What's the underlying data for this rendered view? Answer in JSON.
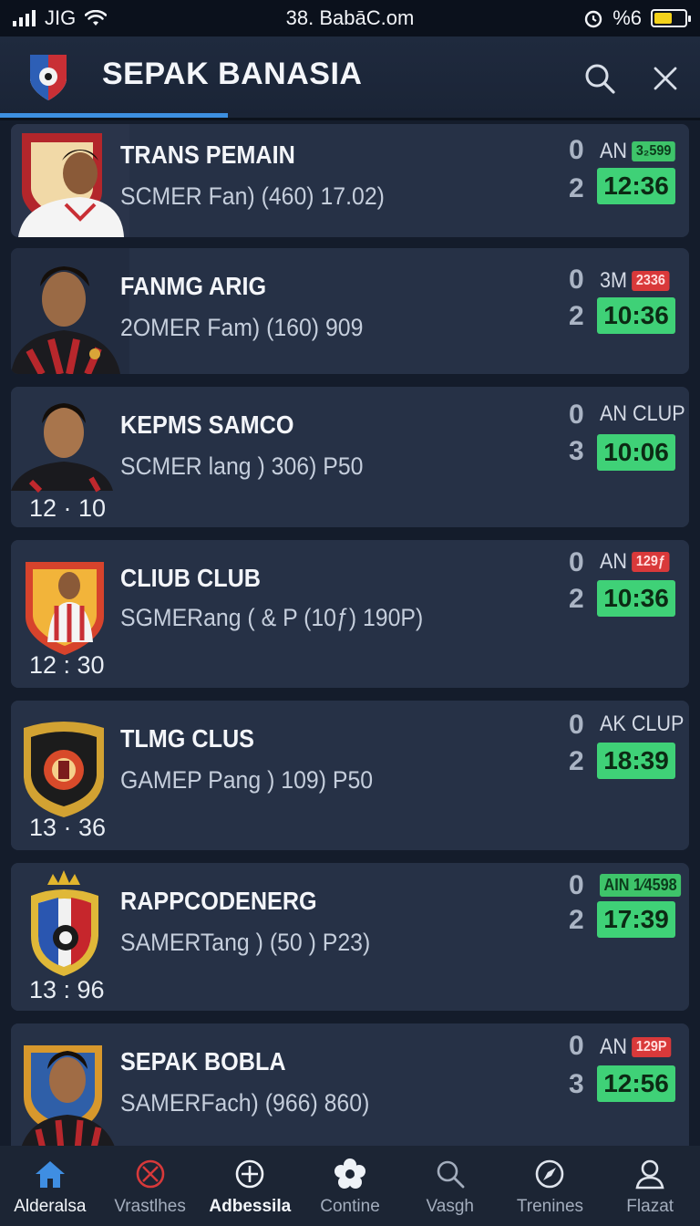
{
  "status": {
    "carrier": "JIG",
    "url": "38. BabāC.om",
    "battery_pct": "%6",
    "battery_level": 0.6
  },
  "header": {
    "title": "SEPAK BANASIA"
  },
  "matches": [
    {
      "name": "TRANS PEMAIN",
      "sub": "SCMER Fan) (460) 17.02)",
      "score_top": "0",
      "meta": "AN",
      "tag": "3₂599",
      "tag_color": "green",
      "score_bottom": "2",
      "time": "12:36",
      "kickoff": ""
    },
    {
      "name": "FANMG ARIG",
      "sub": "2OMER Fam) (160) 909",
      "score_top": "0",
      "meta": "3M",
      "tag": "2336",
      "tag_color": "red",
      "score_bottom": "2",
      "time": "10:36",
      "kickoff": ""
    },
    {
      "name": "KEPMS SAMCO",
      "sub": "SCMER lang ) 306) P50",
      "score_top": "0",
      "meta": "AN CLUP",
      "tag": "",
      "tag_color": "",
      "score_bottom": "3",
      "time": "10:06",
      "kickoff": "12 · 10"
    },
    {
      "name": "CLIUB CLUB",
      "sub": "SGMERang ( & P (10ƒ) 190P)",
      "score_top": "0",
      "meta": "AN",
      "tag": "129ƒ",
      "tag_color": "red",
      "score_bottom": "2",
      "time": "10:36",
      "kickoff": "12 : 30"
    },
    {
      "name": "TLMG CLUS",
      "sub": "GAMEP Pang ) 109) P50",
      "score_top": "0",
      "meta": "AK CLUP",
      "tag": "",
      "tag_color": "",
      "score_bottom": "2",
      "time": "18:39",
      "kickoff": "13 · 36"
    },
    {
      "name": "RAPPCODENERG",
      "sub": "SAMERTang ) (50 ) P23)",
      "score_top": "0",
      "meta": "",
      "tag": "AIN 1⁄4598",
      "tag_color": "green",
      "score_bottom": "2",
      "time": "17:39",
      "kickoff": "13 : 96"
    },
    {
      "name": "SEPAK BOBLA",
      "sub": "SAMERFach) (966) 860)",
      "score_top": "0",
      "meta": "AN",
      "tag": "129P",
      "tag_color": "red",
      "score_bottom": "3",
      "time": "12:56",
      "kickoff": ""
    }
  ],
  "nav": [
    {
      "label": "Alderalsa",
      "icon": "home-icon"
    },
    {
      "label": "Vrastlhes",
      "icon": "ban-icon"
    },
    {
      "label": "Adbessila",
      "icon": "crosshair-plus-icon"
    },
    {
      "label": "Contine",
      "icon": "flower-icon"
    },
    {
      "label": "Vasgh",
      "icon": "search-icon"
    },
    {
      "label": "Trenines",
      "icon": "compass-icon"
    },
    {
      "label": "Flazat",
      "icon": "user-icon"
    }
  ],
  "colors": {
    "accent": "#3d8fe0",
    "time_badge": "#3fd177",
    "red_tag": "#d9393a",
    "card": "#263146"
  }
}
